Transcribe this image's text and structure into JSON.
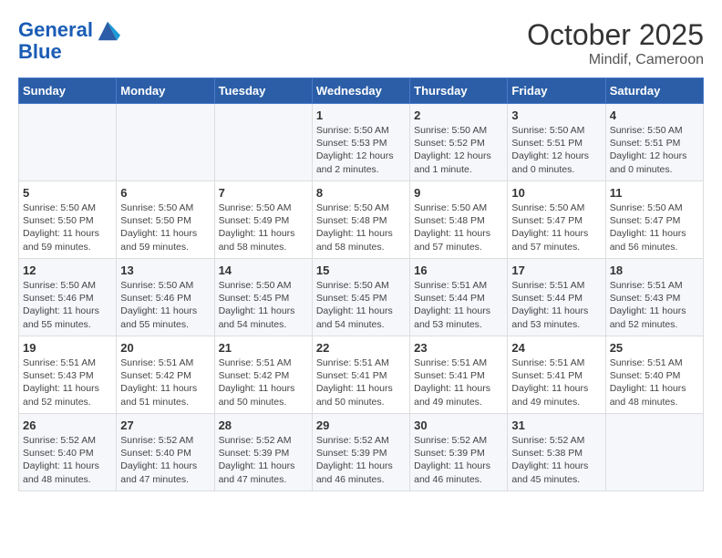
{
  "header": {
    "logo_line1": "General",
    "logo_line2": "Blue",
    "month": "October 2025",
    "location": "Mindif, Cameroon"
  },
  "days_of_week": [
    "Sunday",
    "Monday",
    "Tuesday",
    "Wednesday",
    "Thursday",
    "Friday",
    "Saturday"
  ],
  "weeks": [
    [
      {
        "day": "",
        "content": ""
      },
      {
        "day": "",
        "content": ""
      },
      {
        "day": "",
        "content": ""
      },
      {
        "day": "1",
        "content": "Sunrise: 5:50 AM\nSunset: 5:53 PM\nDaylight: 12 hours\nand 2 minutes."
      },
      {
        "day": "2",
        "content": "Sunrise: 5:50 AM\nSunset: 5:52 PM\nDaylight: 12 hours\nand 1 minute."
      },
      {
        "day": "3",
        "content": "Sunrise: 5:50 AM\nSunset: 5:51 PM\nDaylight: 12 hours\nand 0 minutes."
      },
      {
        "day": "4",
        "content": "Sunrise: 5:50 AM\nSunset: 5:51 PM\nDaylight: 12 hours\nand 0 minutes."
      }
    ],
    [
      {
        "day": "5",
        "content": "Sunrise: 5:50 AM\nSunset: 5:50 PM\nDaylight: 11 hours\nand 59 minutes."
      },
      {
        "day": "6",
        "content": "Sunrise: 5:50 AM\nSunset: 5:50 PM\nDaylight: 11 hours\nand 59 minutes."
      },
      {
        "day": "7",
        "content": "Sunrise: 5:50 AM\nSunset: 5:49 PM\nDaylight: 11 hours\nand 58 minutes."
      },
      {
        "day": "8",
        "content": "Sunrise: 5:50 AM\nSunset: 5:48 PM\nDaylight: 11 hours\nand 58 minutes."
      },
      {
        "day": "9",
        "content": "Sunrise: 5:50 AM\nSunset: 5:48 PM\nDaylight: 11 hours\nand 57 minutes."
      },
      {
        "day": "10",
        "content": "Sunrise: 5:50 AM\nSunset: 5:47 PM\nDaylight: 11 hours\nand 57 minutes."
      },
      {
        "day": "11",
        "content": "Sunrise: 5:50 AM\nSunset: 5:47 PM\nDaylight: 11 hours\nand 56 minutes."
      }
    ],
    [
      {
        "day": "12",
        "content": "Sunrise: 5:50 AM\nSunset: 5:46 PM\nDaylight: 11 hours\nand 55 minutes."
      },
      {
        "day": "13",
        "content": "Sunrise: 5:50 AM\nSunset: 5:46 PM\nDaylight: 11 hours\nand 55 minutes."
      },
      {
        "day": "14",
        "content": "Sunrise: 5:50 AM\nSunset: 5:45 PM\nDaylight: 11 hours\nand 54 minutes."
      },
      {
        "day": "15",
        "content": "Sunrise: 5:50 AM\nSunset: 5:45 PM\nDaylight: 11 hours\nand 54 minutes."
      },
      {
        "day": "16",
        "content": "Sunrise: 5:51 AM\nSunset: 5:44 PM\nDaylight: 11 hours\nand 53 minutes."
      },
      {
        "day": "17",
        "content": "Sunrise: 5:51 AM\nSunset: 5:44 PM\nDaylight: 11 hours\nand 53 minutes."
      },
      {
        "day": "18",
        "content": "Sunrise: 5:51 AM\nSunset: 5:43 PM\nDaylight: 11 hours\nand 52 minutes."
      }
    ],
    [
      {
        "day": "19",
        "content": "Sunrise: 5:51 AM\nSunset: 5:43 PM\nDaylight: 11 hours\nand 52 minutes."
      },
      {
        "day": "20",
        "content": "Sunrise: 5:51 AM\nSunset: 5:42 PM\nDaylight: 11 hours\nand 51 minutes."
      },
      {
        "day": "21",
        "content": "Sunrise: 5:51 AM\nSunset: 5:42 PM\nDaylight: 11 hours\nand 50 minutes."
      },
      {
        "day": "22",
        "content": "Sunrise: 5:51 AM\nSunset: 5:41 PM\nDaylight: 11 hours\nand 50 minutes."
      },
      {
        "day": "23",
        "content": "Sunrise: 5:51 AM\nSunset: 5:41 PM\nDaylight: 11 hours\nand 49 minutes."
      },
      {
        "day": "24",
        "content": "Sunrise: 5:51 AM\nSunset: 5:41 PM\nDaylight: 11 hours\nand 49 minutes."
      },
      {
        "day": "25",
        "content": "Sunrise: 5:51 AM\nSunset: 5:40 PM\nDaylight: 11 hours\nand 48 minutes."
      }
    ],
    [
      {
        "day": "26",
        "content": "Sunrise: 5:52 AM\nSunset: 5:40 PM\nDaylight: 11 hours\nand 48 minutes."
      },
      {
        "day": "27",
        "content": "Sunrise: 5:52 AM\nSunset: 5:40 PM\nDaylight: 11 hours\nand 47 minutes."
      },
      {
        "day": "28",
        "content": "Sunrise: 5:52 AM\nSunset: 5:39 PM\nDaylight: 11 hours\nand 47 minutes."
      },
      {
        "day": "29",
        "content": "Sunrise: 5:52 AM\nSunset: 5:39 PM\nDaylight: 11 hours\nand 46 minutes."
      },
      {
        "day": "30",
        "content": "Sunrise: 5:52 AM\nSunset: 5:39 PM\nDaylight: 11 hours\nand 46 minutes."
      },
      {
        "day": "31",
        "content": "Sunrise: 5:52 AM\nSunset: 5:38 PM\nDaylight: 11 hours\nand 45 minutes."
      },
      {
        "day": "",
        "content": ""
      }
    ]
  ]
}
